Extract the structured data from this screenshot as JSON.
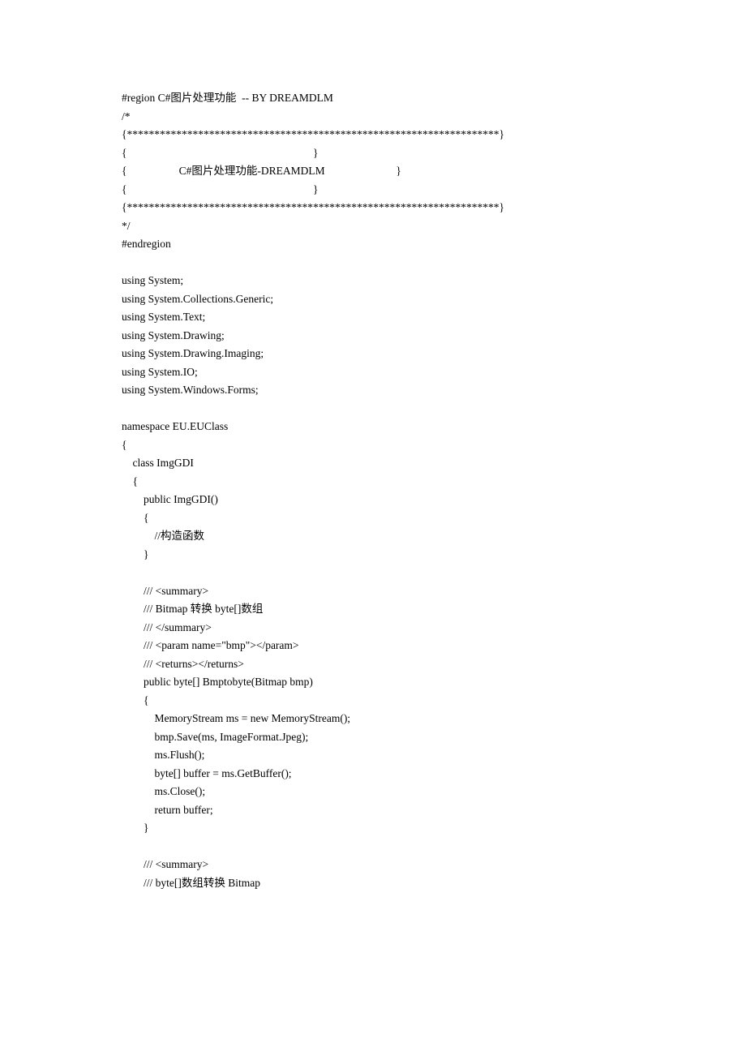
{
  "lines": [
    "#region C#图片处理功能  -- BY DREAMDLM",
    "/*",
    "{********************************************************************}",
    "{                                                                    }",
    "{                   C#图片处理功能-DREAMDLM                          }",
    "{                                                                    }",
    "{********************************************************************}",
    "*/",
    "#endregion",
    "",
    "using System;",
    "using System.Collections.Generic;",
    "using System.Text;",
    "using System.Drawing;",
    "using System.Drawing.Imaging;",
    "using System.IO;",
    "using System.Windows.Forms;",
    "",
    "namespace EU.EUClass",
    "{",
    "    class ImgGDI",
    "    {",
    "        public ImgGDI()",
    "        {",
    "            //构造函数",
    "        }",
    "",
    "        /// <summary>",
    "        /// Bitmap 转换 byte[]数组",
    "        /// </summary>",
    "        /// <param name=\"bmp\"></param>",
    "        /// <returns></returns>",
    "        public byte[] Bmptobyte(Bitmap bmp)",
    "        {",
    "            MemoryStream ms = new MemoryStream();",
    "            bmp.Save(ms, ImageFormat.Jpeg);",
    "            ms.Flush();",
    "            byte[] buffer = ms.GetBuffer();",
    "            ms.Close();",
    "            return buffer;",
    "        }",
    "",
    "        /// <summary>",
    "        /// byte[]数组转换 Bitmap"
  ]
}
